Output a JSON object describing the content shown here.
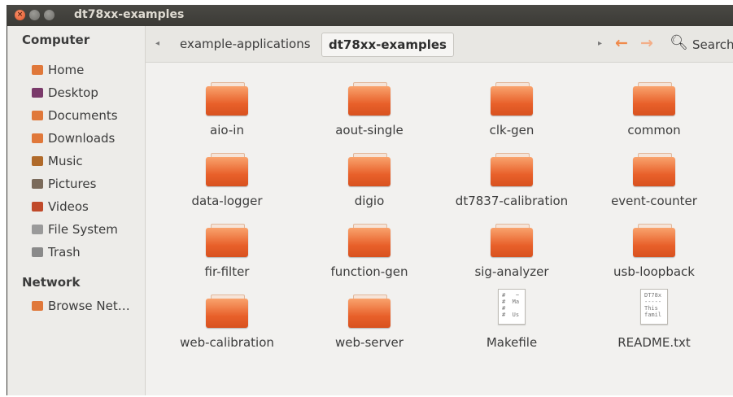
{
  "window": {
    "title": "dt78xx-examples"
  },
  "sidebar": {
    "sections": [
      {
        "heading": "Computer",
        "items": [
          {
            "label": "Home",
            "icon": "home-icon",
            "color": "#e0783a"
          },
          {
            "label": "Desktop",
            "icon": "desktop-icon",
            "color": "#7a3a6a"
          },
          {
            "label": "Documents",
            "icon": "documents-icon",
            "color": "#e0783a"
          },
          {
            "label": "Downloads",
            "icon": "downloads-icon",
            "color": "#e0783a"
          },
          {
            "label": "Music",
            "icon": "music-icon",
            "color": "#b06a2a"
          },
          {
            "label": "Pictures",
            "icon": "pictures-icon",
            "color": "#7a6a5a"
          },
          {
            "label": "Videos",
            "icon": "videos-icon",
            "color": "#c04a2a"
          },
          {
            "label": "File System",
            "icon": "filesystem-icon",
            "color": "#9a9a9a"
          },
          {
            "label": "Trash",
            "icon": "trash-icon",
            "color": "#8a8a8a"
          }
        ]
      },
      {
        "heading": "Network",
        "items": [
          {
            "label": "Browse Net…",
            "icon": "network-icon",
            "color": "#e0783a"
          }
        ]
      }
    ]
  },
  "toolbar": {
    "breadcrumbs": [
      "example-applications",
      "dt78xx-examples"
    ],
    "search_label": "Search"
  },
  "files": [
    {
      "name": "aio-in",
      "kind": "folder"
    },
    {
      "name": "aout-single",
      "kind": "folder"
    },
    {
      "name": "clk-gen",
      "kind": "folder"
    },
    {
      "name": "common",
      "kind": "folder"
    },
    {
      "name": "data-logger",
      "kind": "folder"
    },
    {
      "name": "digio",
      "kind": "folder"
    },
    {
      "name": "dt7837-calibration",
      "kind": "folder"
    },
    {
      "name": "event-counter",
      "kind": "folder"
    },
    {
      "name": "fir-filter",
      "kind": "folder"
    },
    {
      "name": "function-gen",
      "kind": "folder"
    },
    {
      "name": "sig-analyzer",
      "kind": "folder"
    },
    {
      "name": "usb-loopback",
      "kind": "folder"
    },
    {
      "name": "web-calibration",
      "kind": "folder"
    },
    {
      "name": "web-server",
      "kind": "folder"
    },
    {
      "name": "Makefile",
      "kind": "text",
      "preview": "#   ~\n#  Ma\n#\n#  Us"
    },
    {
      "name": "README.txt",
      "kind": "text",
      "preview": "DT78x\n-----\nThis\nfamil"
    }
  ]
}
